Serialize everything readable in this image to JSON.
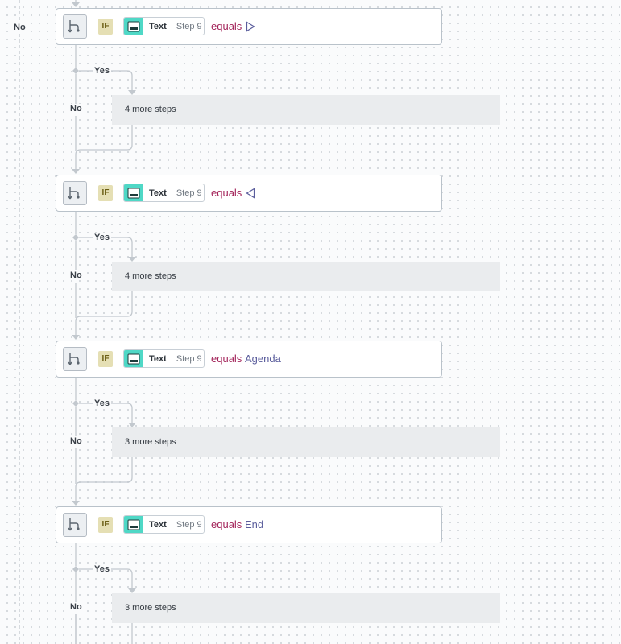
{
  "outer_no_label": "No",
  "blocks": [
    {
      "if_label": "IF",
      "field": "Text",
      "step": "Step 9",
      "operator": "equals",
      "value": "",
      "value_icon": "triangle-right-icon",
      "yes": "Yes",
      "no": "No",
      "more": "4 more steps"
    },
    {
      "if_label": "IF",
      "field": "Text",
      "step": "Step 9",
      "operator": "equals",
      "value": "",
      "value_icon": "triangle-left-icon",
      "yes": "Yes",
      "no": "No",
      "more": "4 more steps"
    },
    {
      "if_label": "IF",
      "field": "Text",
      "step": "Step 9",
      "operator": "equals",
      "value": "Agenda",
      "value_icon": "",
      "yes": "Yes",
      "no": "No",
      "more": "3 more steps"
    },
    {
      "if_label": "IF",
      "field": "Text",
      "step": "Step 9",
      "operator": "equals",
      "value": "End",
      "value_icon": "",
      "yes": "Yes",
      "no": "No",
      "more": "3 more steps"
    }
  ],
  "colors": {
    "operator": "#a3245a",
    "value": "#5a5d9c",
    "app_icon_bg": "#4fd8c6",
    "if_badge_bg": "#e5dfb4",
    "line": "#c2c8ce"
  }
}
